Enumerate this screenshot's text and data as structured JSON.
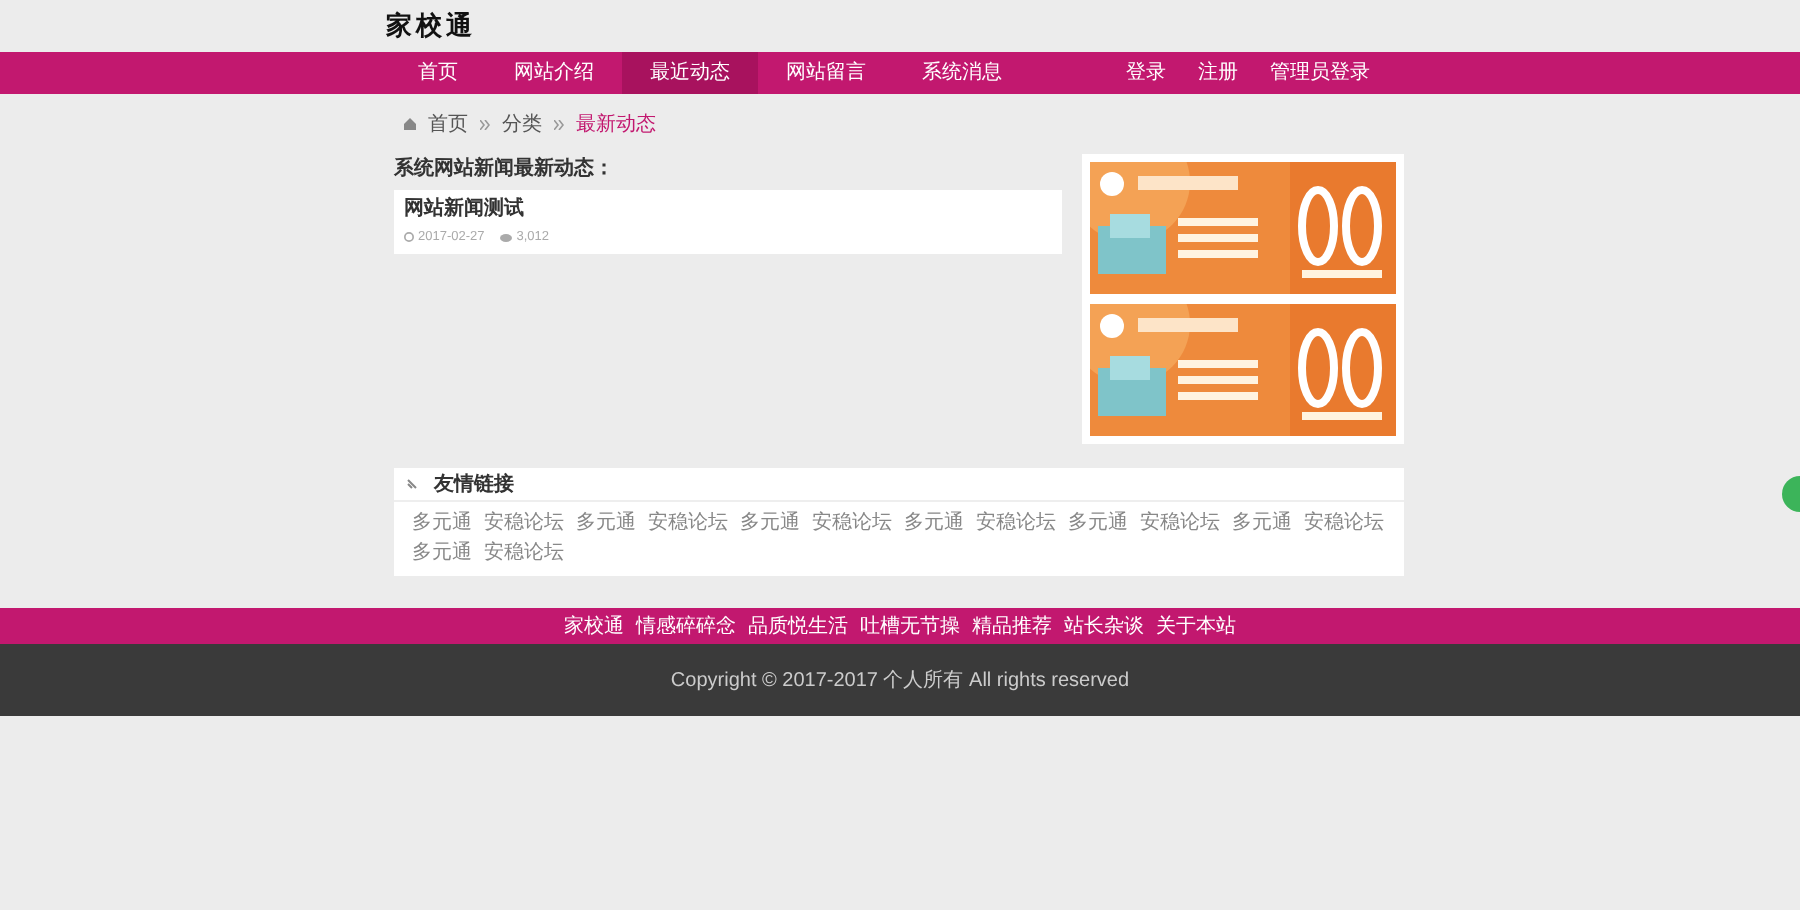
{
  "site_title": "家校通",
  "nav": {
    "items": [
      {
        "label": "首页",
        "selected": false
      },
      {
        "label": "网站介绍",
        "selected": false
      },
      {
        "label": "最近动态",
        "selected": true
      },
      {
        "label": "网站留言",
        "selected": false
      },
      {
        "label": "系统消息",
        "selected": false
      }
    ],
    "account": [
      "登录",
      "注册",
      "管理员登录"
    ]
  },
  "breadcrumb": [
    "首页",
    "分类",
    "最新动态"
  ],
  "section_title": "系统网站新闻最新动态：",
  "articles": [
    {
      "title": "网站新闻测试",
      "date": "2017-02-27",
      "views": "3,012"
    }
  ],
  "links": {
    "title": "友情链接",
    "items": [
      "多元通",
      "安稳论坛",
      "多元通",
      "安稳论坛",
      "多元通",
      "安稳论坛",
      "多元通",
      "安稳论坛",
      "多元通",
      "安稳论坛",
      "多元通",
      "安稳论坛",
      "多元通",
      "安稳论坛"
    ]
  },
  "footer": {
    "links": [
      "家校通",
      "情感碎碎念",
      "品质悦生活",
      "吐槽无节操",
      "精品推荐",
      "站长杂谈",
      "关于本站"
    ],
    "copyright": "Copyright © 2017-2017 个人所有 All rights reserved"
  }
}
